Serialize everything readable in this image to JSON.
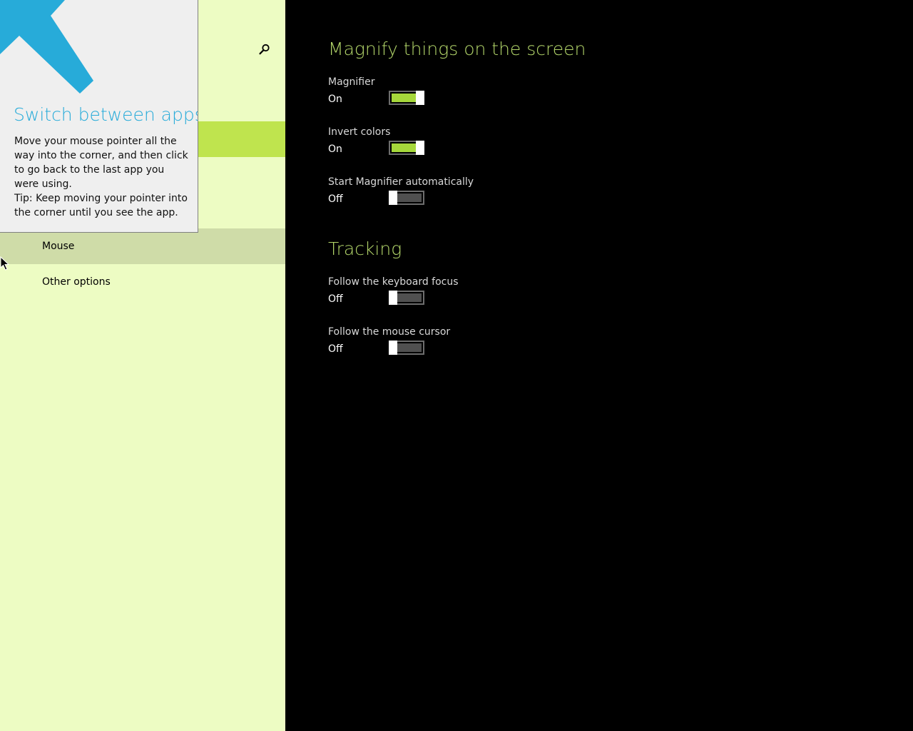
{
  "nav": {
    "items": [
      {
        "label": "Mouse"
      },
      {
        "label": "Other options"
      }
    ]
  },
  "tip": {
    "title": "Switch between apps",
    "body_line1": "Move your mouse pointer all the way into the corner, and then click to go back to the last app you were using.",
    "body_line2": "Tip: Keep moving your pointer into the corner until you see the app."
  },
  "content": {
    "section1": {
      "title": "Magnify things on the screen",
      "settings": [
        {
          "label": "Magnifier",
          "state": "On",
          "on": true
        },
        {
          "label": "Invert colors",
          "state": "On",
          "on": true
        },
        {
          "label": "Start Magnifier automatically",
          "state": "Off",
          "on": false
        }
      ]
    },
    "section2": {
      "title": "Tracking",
      "settings": [
        {
          "label": "Follow the keyboard focus",
          "state": "Off",
          "on": false
        },
        {
          "label": "Follow the mouse cursor",
          "state": "Off",
          "on": false
        }
      ]
    }
  },
  "colors": {
    "nav_bg": "#edfcc3",
    "nav_selected": "#bfe44e",
    "accent": "#b3d66a",
    "toggle_on": "#a6d83b",
    "tip_title": "#27abd9"
  },
  "icons": {
    "search": "search-icon",
    "tip_arrow": "arrow-up-left-icon",
    "cursor": "mouse-cursor-icon"
  }
}
